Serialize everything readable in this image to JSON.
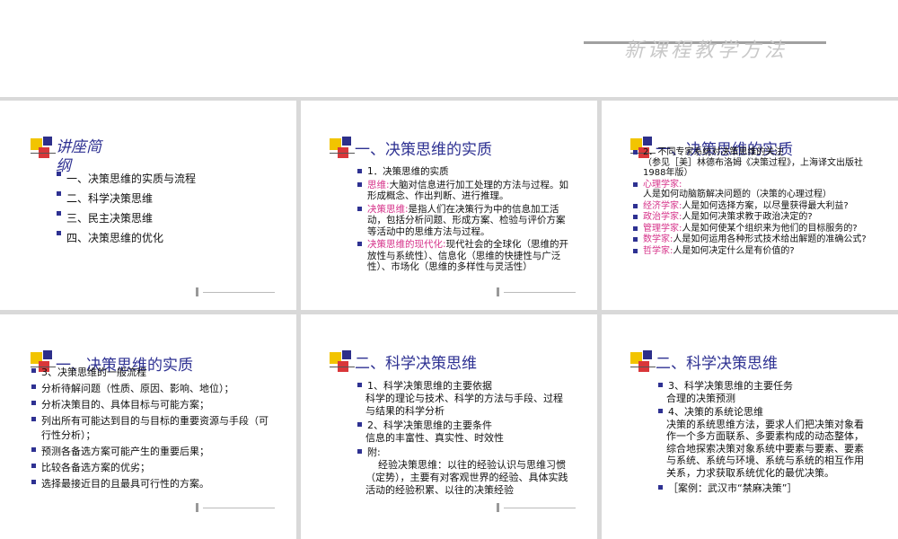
{
  "header": {
    "decor_text": "新课程教学方法"
  },
  "slide1": {
    "title": "讲座简纲",
    "items": [
      "一、决策思维的实质与流程",
      "二、科学决策思维",
      "三、民主决策思维",
      "四、决策思维的优化"
    ]
  },
  "slide2": {
    "title": "一、决策思维的实质",
    "sub": "1．决策思维的实质",
    "p1_term": "思维:",
    "p1_text": "大脑对信息进行加工处理的方法与过程。如形成概念、作出判断、进行推理。",
    "p2_term": "决策思维:",
    "p2_text": "是指人们在决策行为中的信息加工活动，包括分析问题、形成方案、检验与评价方案等活动中的思维方法与过程。",
    "p3_term": "决策思维的现代化:",
    "p3_text": "现代社会的全球化（思维的开放性与系统性）、信息化（思维的快捷性与广泛性）、市场化（思维的多样性与灵活性）"
  },
  "slide3": {
    "title": "一、决策思维的实质",
    "intro": "2．不同专家系统对决策思维的关注",
    "ref": "（参见［美］林德布洛姆《决策过程》，上海译文出版社1988年版）",
    "items": [
      {
        "term": "心理学家:",
        "text": "人是如何动脑筋解决问题的（决策的心理过程）"
      },
      {
        "term": "经济学家:",
        "text": "人是如何选择方案，以尽量获得最大利益?"
      },
      {
        "term": "政治学家:",
        "text": "人是如何决策求教于政治决定的?"
      },
      {
        "term": "管理学家:",
        "text": "人是如何使某个组织来为他们的目标服务的?"
      },
      {
        "term": "数学家:",
        "text": "人是如何运用各种形式技术给出解题的准确公式?"
      },
      {
        "term": "哲学家:",
        "text": "人是如何决定什么是有价值的?"
      }
    ]
  },
  "slide4": {
    "title": "一、决策思维的实质",
    "sub": "3、决策思维的一般流程",
    "items": [
      "分析待解问题（性质、原因、影响、地位）；",
      "分析决策目的、具体目标与可能方案；",
      "列出所有可能达到目的与目标的重要资源与手段（可行性分析）；",
      "预测各备选方案可能产生的重要后果；",
      "比较各备选方案的优劣；",
      "选择最接近目的且最具可行性的方案。"
    ]
  },
  "slide5": {
    "title": "二、科学决策思维",
    "p1_head": "1、科学决策思维的主要依据",
    "p1_body": "科学的理论与技术、科学的方法与手段、过程与结果的科学分析",
    "p2_head": "2、科学决策思维的主要条件",
    "p2_body": "信息的丰富性、真实性、时效性",
    "p3_head": "附:",
    "p3_body": "经验决策思维：以往的经验认识与思维习惯（定势），主要有对客观世界的经验、具体实践活动的经验积累、以往的决策经验"
  },
  "slide6": {
    "title": "二、科学决策思维",
    "p1_head": "3、科学决策思维的主要任务",
    "p1_body": "合理的决策预测",
    "p2_head": "4、决策的系统论思维",
    "p2_body": "决策的系统思维方法，要求人们把决策对象看作一个多方面联系、多要素构成的动态整体，综合地探索决策对象系统中要素与要素、要素与系统、系统与环境、系统与系统的相互作用关系，力求获取系统优化的最优决策。",
    "case": "［案例：武汉市“禁麻决策”］"
  }
}
